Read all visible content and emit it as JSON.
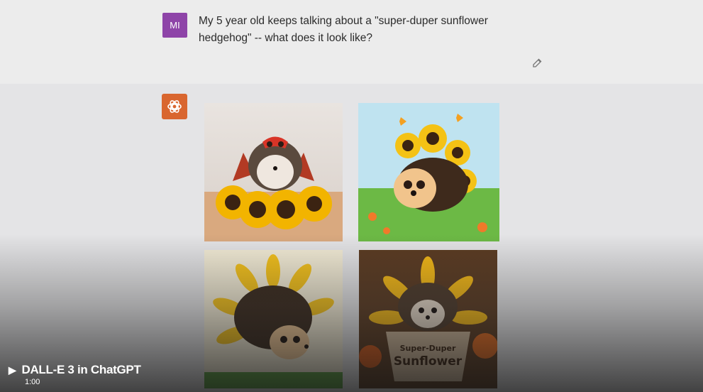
{
  "user_message": {
    "avatar_initials": "MI",
    "text": "My 5 year old keeps talking about a \"super-duper sunflower hedgehog\" -- what does it look like?",
    "avatar_color": "#8e44a8"
  },
  "assistant": {
    "avatar_icon": "openai-logo-icon",
    "avatar_color": "#d9662f",
    "images": [
      {
        "subject": "hedgehog-with-red-mask-and-cape-among-sunflowers"
      },
      {
        "subject": "cartoon-hedgehog-with-sunflower-crown-and-butterflies"
      },
      {
        "subject": "hedgehog-inside-sunflower-illustration"
      },
      {
        "subject": "hedgehog-in-pot-labeled-super-duper-sunflower"
      }
    ],
    "pot_label_line1": "Super-Duper",
    "pot_label_line2": "Sunflower"
  },
  "video": {
    "title": "DALL-E 3 in ChatGPT",
    "duration": "1:00"
  }
}
